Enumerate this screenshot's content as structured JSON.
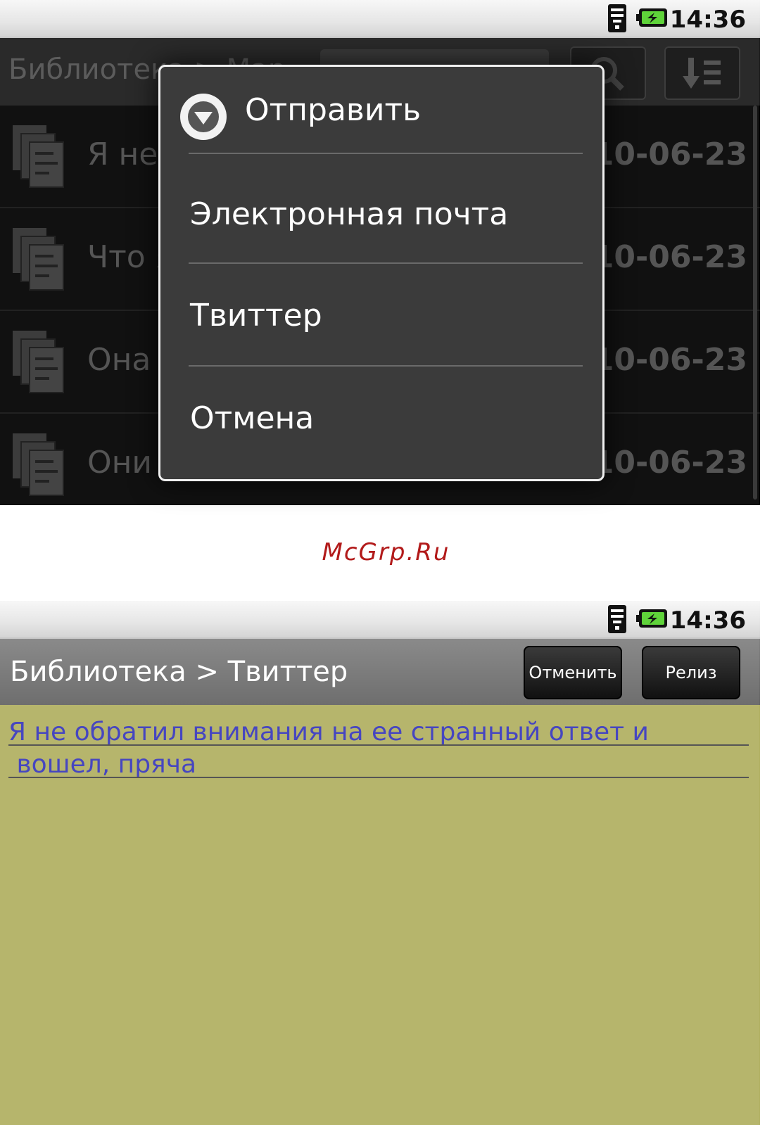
{
  "status_bar": {
    "time": "14:36",
    "icons": [
      "wifi-signal-icon",
      "battery-charging-icon"
    ]
  },
  "screen1": {
    "breadcrumb": "Библиотека > Мар...",
    "buttons": [
      "search-icon",
      "sort-icon"
    ],
    "rows": [
      {
        "title": "Я не обрат...",
        "date": "2010-06-23"
      },
      {
        "title": "Что я поду...",
        "date": "2010-06-23"
      },
      {
        "title": "Она не по...",
        "date": "2010-06-23"
      },
      {
        "title": "Они как ра...",
        "date": "2010-06-23"
      }
    ],
    "dialog": {
      "title": "Отправить",
      "items": [
        "Электронная почта",
        "Твиттер",
        "Отмена"
      ]
    }
  },
  "watermark": "McGrp.Ru",
  "screen2": {
    "breadcrumb": "Библиотека > Твиттер",
    "cancel_label": "Отменить",
    "release_label": "Релиз",
    "text_lines": [
      "Я не обратил внимания на ее странный ответ и",
      " вошел, пряча"
    ],
    "colors": {
      "background": "#b6b56c",
      "link": "#4646c0"
    }
  }
}
